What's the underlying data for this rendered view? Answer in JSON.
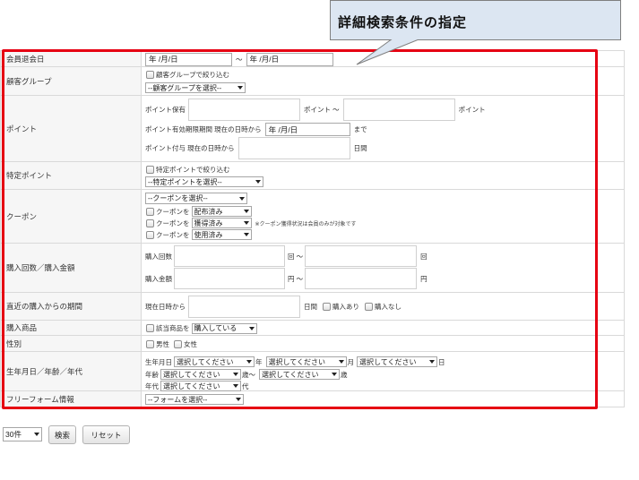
{
  "callout": {
    "title": "詳細検索条件の指定"
  },
  "form": {
    "withdrawal_date": {
      "label": "会員退会日",
      "from_value": "年 /月/日",
      "separator": "～",
      "to_value": "年 /月/日"
    },
    "customer_group": {
      "label": "顧客グループ",
      "checkbox_label": "顧客グループで絞り込む",
      "select_value": "--顧客グループを選択--"
    },
    "points": {
      "label": "ポイント",
      "held_label": "ポイント保有",
      "held_range_text": "ポイント ～",
      "held_unit": "ポイント",
      "expiry_label": "ポイント有効期限期間 現在の日時から",
      "expiry_value": "年 /月/日",
      "expiry_suffix": "まで",
      "grant_label": "ポイント付与 現在の日時から",
      "grant_suffix": "日間"
    },
    "specific_point": {
      "label": "特定ポイント",
      "checkbox_label": "特定ポイントで絞り込む",
      "select_value": "--特定ポイントを選択--"
    },
    "coupon": {
      "label": "クーポン",
      "select_value": "--クーポンを選択--",
      "conditions": [
        {
          "prefix": "クーポンを",
          "status": "配布済み"
        },
        {
          "prefix": "クーポンを",
          "status": "獲得済み",
          "note": "※クーポン獲得状況は会員のみが対象です"
        },
        {
          "prefix": "クーポンを",
          "status": "使用済み"
        }
      ]
    },
    "purchase": {
      "label": "購入回数／購入金額",
      "count_label": "購入回数",
      "count_range_text": "回 ～",
      "count_unit": "回",
      "amount_label": "購入金額",
      "amount_range_text": "円 ～",
      "amount_unit": "円"
    },
    "recent_purchase": {
      "label": "直近の購入からの期間",
      "prefix": "現在日時から",
      "suffix": "日間",
      "has_purchase": "購入あり",
      "no_purchase": "購入なし"
    },
    "product": {
      "label": "購入商品",
      "checkbox_label": "該当商品を",
      "select_value": "購入している"
    },
    "gender": {
      "label": "性別",
      "male": "男性",
      "female": "女性"
    },
    "birth": {
      "label": "生年月日／年齢／年代",
      "birthday_label": "生年月日",
      "year_select": "選択してください",
      "year_unit": "年",
      "month_select": "選択してください",
      "month_unit": "月",
      "day_select": "選択してください",
      "day_unit": "日",
      "age_label": "年齢",
      "age_from_select": "選択してください",
      "age_range_text": "歳～",
      "age_to_select": "選択してください",
      "age_unit": "歳",
      "era_label": "年代",
      "era_select": "選択してください",
      "era_unit": "代"
    },
    "free_form": {
      "label": "フリーフォーム情報",
      "select_value": "--フォームを選択--"
    }
  },
  "footer": {
    "per_page": "30件",
    "search_button": "検索",
    "reset_button": "リセット"
  },
  "icons": {
    "dropdown": "chevron-down-icon"
  },
  "colors": {
    "highlight_border": "#e60012",
    "callout_fill": "#dce6f2",
    "callout_border": "#7f7f7f",
    "label_background": "#f6f6f6"
  }
}
